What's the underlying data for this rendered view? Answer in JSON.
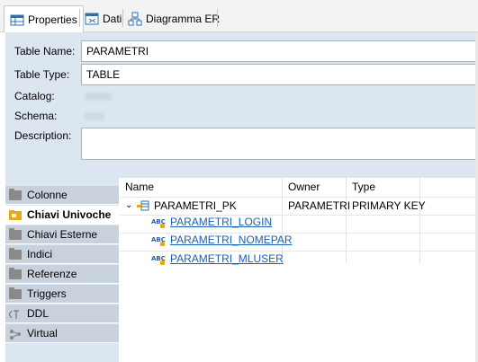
{
  "tabs": [
    {
      "label": "Properties",
      "icon": "table-properties-icon",
      "active": true
    },
    {
      "label": "Dati",
      "icon": "grid-data-icon",
      "active": false
    },
    {
      "label": "Diagramma ER",
      "icon": "er-diagram-icon",
      "active": false
    }
  ],
  "form": {
    "table_name_label": "Table Name:",
    "table_name_value": "PARAMETRI",
    "table_type_label": "Table Type:",
    "table_type_value": "TABLE",
    "catalog_label": "Catalog:",
    "schema_label": "Schema:",
    "description_label": "Description:"
  },
  "side_tabs": [
    {
      "label": "Colonne",
      "icon": "folder-icon"
    },
    {
      "label": "Chiavi Univoche",
      "icon": "unique-key-folder-icon"
    },
    {
      "label": "Chiavi Esterne",
      "icon": "folder-icon"
    },
    {
      "label": "Indici",
      "icon": "folder-icon"
    },
    {
      "label": "Referenze",
      "icon": "folder-icon"
    },
    {
      "label": "Triggers",
      "icon": "folder-icon"
    },
    {
      "label": "DDL",
      "icon": "ddl-icon"
    },
    {
      "label": "Virtual",
      "icon": "virtual-icon"
    }
  ],
  "active_side_tab": "Chiavi Univoche",
  "table": {
    "columns": [
      "Name",
      "Owner",
      "Type"
    ],
    "key_row": {
      "name": "PARAMETRI_PK",
      "owner": "PARAMETRI",
      "type": "PRIMARY KEY"
    },
    "key_columns": [
      "PARAMETRI_LOGIN",
      "PARAMETRI_NOMEPAR",
      "PARAMETRI_MLUSER"
    ]
  },
  "colors": {
    "panel_bg": "#dce6f0",
    "side_tab_bg": "#c9d2dc",
    "link": "#1a5fb4",
    "key_icon": "#e6a817"
  }
}
